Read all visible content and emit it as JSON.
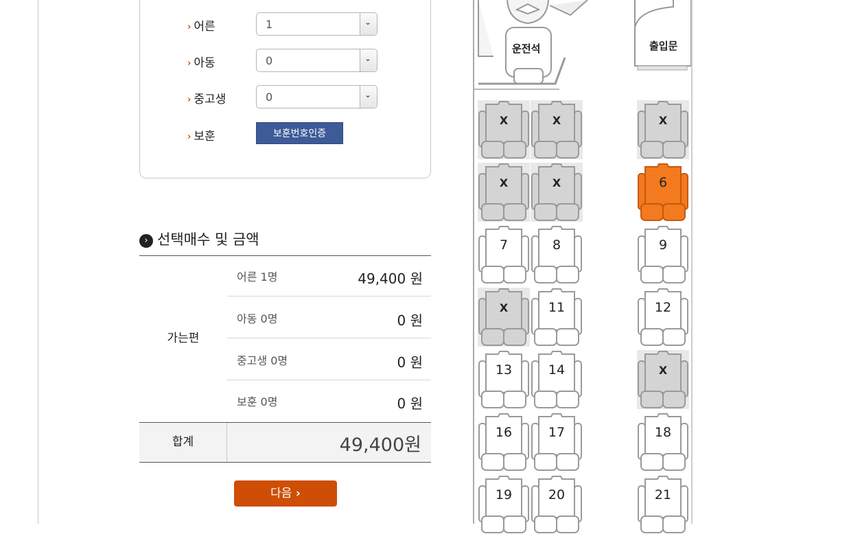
{
  "passengers": [
    {
      "label": "어른",
      "value": "1",
      "type": "select"
    },
    {
      "label": "아동",
      "value": "0",
      "type": "select"
    },
    {
      "label": "중고생",
      "value": "0",
      "type": "select"
    },
    {
      "label": "보훈",
      "button": "보훈번호인증",
      "type": "button"
    }
  ],
  "summary": {
    "title": "선택매수 및 금액",
    "group_label": "가는편",
    "rows": [
      {
        "label": "어른 1명",
        "amount": "49,400 원"
      },
      {
        "label": "아동 0명",
        "amount": "0 원"
      },
      {
        "label": "중고생 0명",
        "amount": "0 원"
      },
      {
        "label": "보훈 0명",
        "amount": "0 원"
      }
    ],
    "total_label": "합계",
    "total_amount": "49,400원"
  },
  "next_button": "다음",
  "bus": {
    "driver_label": "운전석",
    "door_label": "출입문",
    "sold_mark": "X",
    "colors": {
      "selected": "#f37a1f",
      "sold": "#d4d4d4",
      "free": "#ffffff"
    },
    "seats": [
      {
        "id": "1",
        "status": "sold"
      },
      {
        "id": "2",
        "status": "sold"
      },
      {
        "id": "3",
        "status": "sold"
      },
      {
        "id": "4",
        "status": "sold"
      },
      {
        "id": "5",
        "status": "sold"
      },
      {
        "id": "6",
        "status": "selected"
      },
      {
        "id": "7",
        "status": "free"
      },
      {
        "id": "8",
        "status": "free"
      },
      {
        "id": "9",
        "status": "free"
      },
      {
        "id": "10",
        "status": "sold"
      },
      {
        "id": "11",
        "status": "free"
      },
      {
        "id": "12",
        "status": "free"
      },
      {
        "id": "13",
        "status": "free"
      },
      {
        "id": "14",
        "status": "free"
      },
      {
        "id": "15",
        "status": "sold"
      },
      {
        "id": "16",
        "status": "free"
      },
      {
        "id": "17",
        "status": "free"
      },
      {
        "id": "18",
        "status": "free"
      },
      {
        "id": "19",
        "status": "free"
      },
      {
        "id": "20",
        "status": "free"
      },
      {
        "id": "21",
        "status": "free"
      }
    ]
  }
}
